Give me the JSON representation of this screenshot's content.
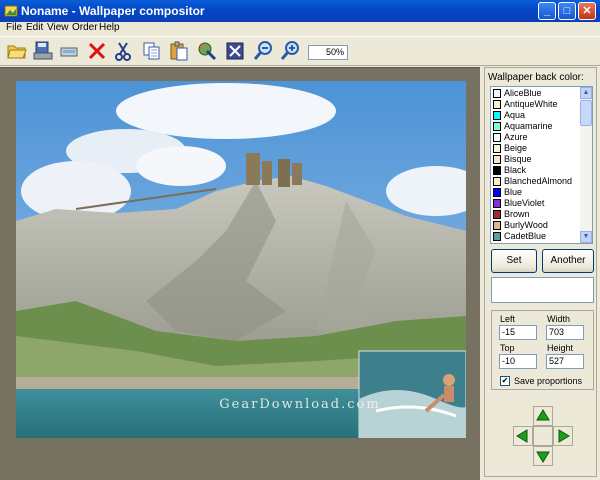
{
  "window": {
    "title": "Noname - Wallpaper compositor",
    "minimize": "_",
    "maximize": "□",
    "close": "✕"
  },
  "menu": [
    "File",
    "Edit",
    "View",
    "Order",
    "Help"
  ],
  "toolbar": {
    "icons": [
      "open-icon",
      "save-icon",
      "scan-icon",
      "delete-icon",
      "cut-icon",
      "copy-icon",
      "paste-icon",
      "paint-icon",
      "crop-icon",
      "zoom-out-icon",
      "zoom-in-icon"
    ],
    "zoom": "50%"
  },
  "panel": {
    "bg_label": "Wallpaper back color:",
    "colors": [
      {
        "name": "AliceBlue",
        "hex": "#f0f8ff"
      },
      {
        "name": "AntiqueWhite",
        "hex": "#faebd7"
      },
      {
        "name": "Aqua",
        "hex": "#00ffff"
      },
      {
        "name": "Aquamarine",
        "hex": "#7fffd4"
      },
      {
        "name": "Azure",
        "hex": "#f0ffff"
      },
      {
        "name": "Beige",
        "hex": "#f5f5dc"
      },
      {
        "name": "Bisque",
        "hex": "#ffe4c4"
      },
      {
        "name": "Black",
        "hex": "#000000"
      },
      {
        "name": "BlanchedAlmond",
        "hex": "#ffebcd"
      },
      {
        "name": "Blue",
        "hex": "#0000ff"
      },
      {
        "name": "BlueViolet",
        "hex": "#8a2be2"
      },
      {
        "name": "Brown",
        "hex": "#a52a2a"
      },
      {
        "name": "BurlyWood",
        "hex": "#deb887"
      },
      {
        "name": "CadetBlue",
        "hex": "#5f9ea0"
      }
    ],
    "set_label": "Set",
    "another_label": "Another",
    "left_label": "Left",
    "left_value": "-15",
    "width_label": "Width",
    "width_value": "703",
    "top_label": "Top",
    "top_value": "-10",
    "height_label": "Height",
    "height_value": "527",
    "save_proportions_label": "Save proportions",
    "save_proportions_checked": "✔"
  },
  "watermark": "GearDownload.com"
}
